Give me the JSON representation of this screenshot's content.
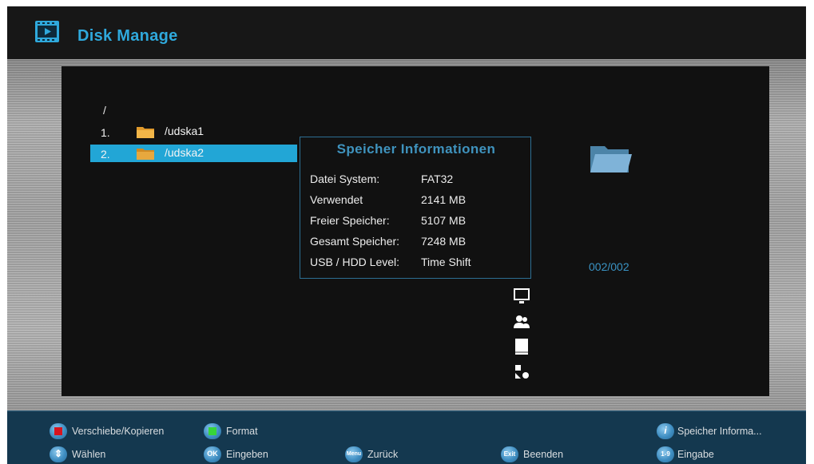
{
  "header": {
    "title": "Disk Manage",
    "icon": "film-screen-icon",
    "accent": "#2fa9dc"
  },
  "file_list": {
    "root_path": "/",
    "items": [
      {
        "number": "1.",
        "name": "/udska1",
        "selected": false
      },
      {
        "number": "2.",
        "name": "/udska2",
        "selected": true
      }
    ],
    "selected_color": "#22a6d6"
  },
  "storage_info": {
    "title": "Speicher Informationen",
    "rows": [
      {
        "label": "Datei System:",
        "value": "FAT32"
      },
      {
        "label": "Verwendet",
        "value": "2141 MB"
      },
      {
        "label": "Freier Speicher:",
        "value": "5107 MB"
      },
      {
        "label": "Gesamt Speicher:",
        "value": "7248 MB"
      },
      {
        "label": "USB / HDD Level:",
        "value": "Time Shift"
      }
    ]
  },
  "preview": {
    "icon": "folder-icon",
    "page_counter": "002/002"
  },
  "side_icons": [
    "monitor-icon",
    "users-icon",
    "book-icon",
    "shapes-icon"
  ],
  "footer": {
    "row1": [
      {
        "key": "red",
        "color": "#d8141e",
        "label": "Verschiebe/Kopieren"
      },
      {
        "key": "green",
        "color": "#37d63a",
        "label": "Format"
      },
      {
        "key": "info",
        "text": "i",
        "label": "Speicher Informa..."
      }
    ],
    "row2": [
      {
        "key": "updown",
        "text": "⇕",
        "label": "Wählen"
      },
      {
        "key": "ok",
        "text": "OK",
        "label": "Eingeben"
      },
      {
        "key": "menu",
        "text": "Menu",
        "label": "Zurück"
      },
      {
        "key": "exit",
        "text": "Exit",
        "label": "Beenden"
      },
      {
        "key": "digits",
        "text": "1-9",
        "label": "Eingabe"
      }
    ]
  }
}
